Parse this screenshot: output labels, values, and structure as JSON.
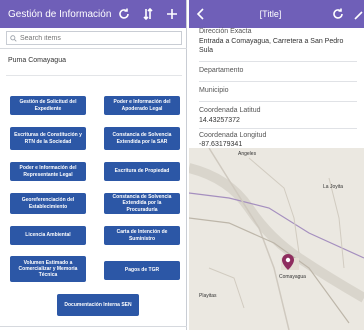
{
  "left": {
    "title": "Gestión de Información",
    "search_placeholder": "Search items",
    "list_item": "Puma Comayagua",
    "buttons": [
      "Gestión de Solicitud del Expediente",
      "Poder e Información del Apoderado Legal",
      "Escrituras de Constitución y RTN de la Sociedad",
      "Constancia de Solvencia Extendida por la SAR",
      "Poder e Información del Representante Legal",
      "Escritura de Propiedad",
      "Georeferenciación del Establecimiento",
      "Constancia de Solvencia Extendida por la Procuraduría",
      "Licencia Ambiental",
      "Carta de Intención de Suministro",
      "Volumen Estimado a Comercializar y Memoria Técnica",
      "Pagos de TGR",
      "Documentación Interna SEN"
    ]
  },
  "right": {
    "title": "[Title]",
    "fields": [
      {
        "label": "Dirección Exacta",
        "value": "Entrada a Comayagua, Carretera a San Pedro Sula"
      },
      {
        "label": "Departamento",
        "value": ""
      },
      {
        "label": "Municipio",
        "value": ""
      },
      {
        "label": "Coordenada Latitud",
        "value": "14.43257372"
      },
      {
        "label": "Coordenada Longitud",
        "value": "-87.63179341"
      }
    ],
    "map": {
      "labels": [
        "Angeles",
        "La Joyita",
        "Comayagua",
        "Playitas"
      ]
    }
  },
  "colors": {
    "header": "#6f5fb8",
    "button": "#2c57a6"
  }
}
